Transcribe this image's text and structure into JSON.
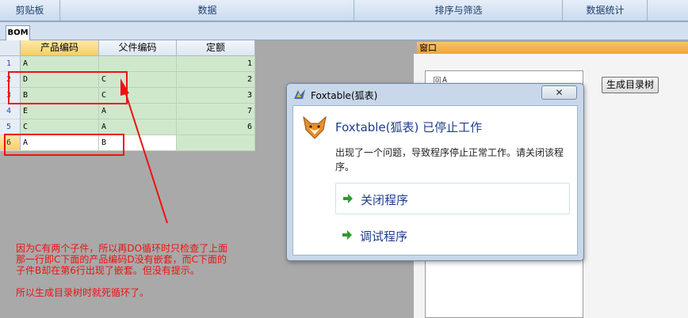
{
  "ribbon": {
    "groups": [
      "剪贴板",
      "数据",
      "排序与筛选",
      "数据统计",
      ""
    ]
  },
  "tab": {
    "label": "BOM"
  },
  "grid": {
    "columns": [
      "产品编码",
      "父件编码",
      "定额"
    ],
    "rows": [
      {
        "num": "1",
        "product": "A",
        "parent": "",
        "quota": "1"
      },
      {
        "num": "2",
        "product": "D",
        "parent": "C",
        "quota": "2"
      },
      {
        "num": "3",
        "product": "B",
        "parent": "C",
        "quota": "3"
      },
      {
        "num": "4",
        "product": "E",
        "parent": "A",
        "quota": "7"
      },
      {
        "num": "5",
        "product": "C",
        "parent": "A",
        "quota": "6"
      },
      {
        "num": "6",
        "product": "A",
        "parent": "B",
        "quota": ""
      }
    ]
  },
  "window_panel": {
    "title": "窗口",
    "tree_root": "A",
    "tree_toggle": "⊟",
    "generate_button": "生成目录树"
  },
  "dialog": {
    "title": "Foxtable(狐表)",
    "close": "✕",
    "heading": "Foxtable(狐表) 已停止工作",
    "message": "出现了一个问题，导致程序停止正常工作。请关闭该程序。",
    "option_close": "关闭程序",
    "option_debug": "调试程序"
  },
  "annotation": {
    "line1": "因为C有两个子件，所以再DO循环时只检查了上面",
    "line2": "那一行即C下面的产品编码D没有嵌套，而C下面的",
    "line3": "子件B却在第6行出现了嵌套。但没有提示。",
    "line4": "所以生成目录树时就死循环了。",
    "color": "#ee1111"
  }
}
